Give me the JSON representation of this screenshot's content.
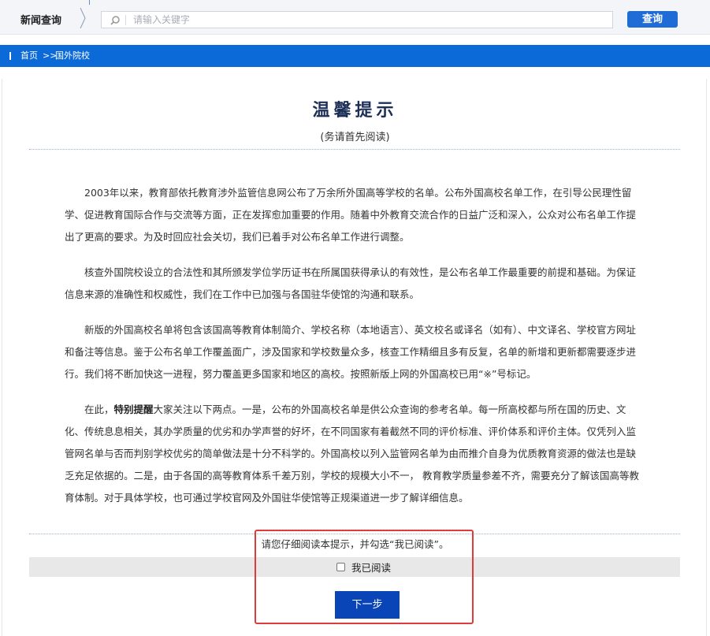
{
  "topbar": {
    "title": "新闻查询",
    "search_placeholder": "请输入关键字",
    "search_value": "",
    "search_button": "查询"
  },
  "breadcrumb": {
    "home": "首页",
    "separator": ">>",
    "current": "国外院校"
  },
  "notice": {
    "title": "温馨提示",
    "subtitle": "(务请首先阅读)",
    "paragraphs": [
      "2003年以来，教育部依托教育涉外监管信息网公布了万余所外国高等学校的名单。公布外国高校名单工作，在引导公民理性留学、促进教育国际合作与交流等方面，正在发挥愈加重要的作用。随着中外教育交流合作的日益广泛和深入，公众对公布名单工作提出了更高的要求。为及时回应社会关切，我们已着手对公布名单工作进行调整。",
      "核查外国院校设立的合法性和其所颁发学位学历证书在所属国获得承认的有效性，是公布名单工作最重要的前提和基础。为保证信息来源的准确性和权威性，我们在工作中已加强与各国驻华使馆的沟通和联系。",
      "新版的外国高校名单将包含该国高等教育体制简介、学校名称（本地语言）、英文校名或译名（如有）、中文译名、学校官方网址和备注等信息。鉴于公布名单工作覆盖面广，涉及国家和学校数量众多，核查工作精细且多有反复，名单的新增和更新都需要逐步进行。我们将不断加快这一进程，努力覆盖更多国家和地区的高校。按照新版上网的外国高校已用“※”号标记。"
    ],
    "p4_prefix": "在此，",
    "p4_bold": "特别提醒",
    "p4_rest": "大家关注以下两点。一是，公布的外国高校名单是供公众查询的参考名单。每一所高校都与所在国的历史、文化、传统息息相关，其办学质量的优劣和办学声誉的好坏，在不同国家有着截然不同的评价标准、评价体系和评价主体。仅凭列入监管网名单与否而判别学校优劣的简单做法是十分不科学的。外国高校以列入监管网名单为由而推介自身为优质教育资源的做法也是缺乏充足依据的。二是，由于各国的高等教育体系千差万别，学校的规模大小不一， 教育教学质量参差不齐，需要充分了解该国高等教育体制。对于具体学校，也可通过学校官网及外国驻华使馆等正规渠道进一步了解详细信息。",
    "confirm_note": "请您仔细阅读本提示，并勾选“我已阅读”。",
    "checkbox_label": "我已阅读",
    "checkbox_checked": false,
    "next_button": "下一步"
  },
  "colors": {
    "primary_blue": "#0b6ad8",
    "button_blue": "#0a45b8",
    "highlight_red": "#e03b3b"
  }
}
